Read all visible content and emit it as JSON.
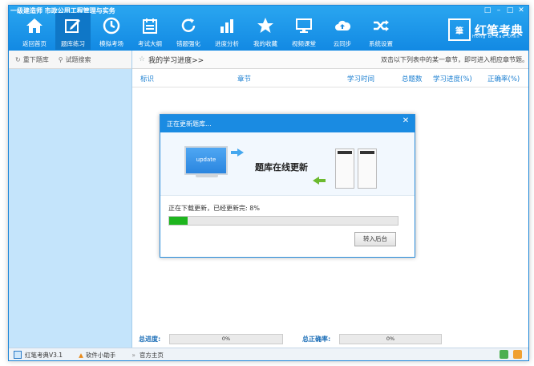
{
  "window": {
    "title": "一级建造师 市政公用工程管理与实务",
    "controls": [
      "□",
      "–",
      "□",
      "✕"
    ]
  },
  "toolbar": {
    "items": [
      {
        "label": "返回首页",
        "icon": "home-icon"
      },
      {
        "label": "题库练习",
        "icon": "edit-icon",
        "active": true
      },
      {
        "label": "模拟考场",
        "icon": "clock-icon"
      },
      {
        "label": "考试大纲",
        "icon": "calendar-icon"
      },
      {
        "label": "错题强化",
        "icon": "refresh-icon"
      },
      {
        "label": "进度分析",
        "icon": "bar-chart-icon"
      },
      {
        "label": "我的收藏",
        "icon": "star-icon"
      },
      {
        "label": "视频课堂",
        "icon": "monitor-icon"
      },
      {
        "label": "云同步",
        "icon": "cloud-icon"
      },
      {
        "label": "系统设置",
        "icon": "shuffle-icon"
      }
    ]
  },
  "brand": {
    "mark": "筆",
    "name": "红笔考典",
    "sub": "Hong Bi Kao Dian"
  },
  "sidebar": {
    "reload_label": "重下题库",
    "search_label": "试题搜索"
  },
  "content": {
    "breadcrumb": "我的学习进度>>",
    "hint": "双击以下列表中的某一章节，即可进入相应章节题。",
    "columns": [
      "标识",
      "章节",
      "学习时间",
      "总题数",
      "学习进度(%)",
      "正确率(%)"
    ]
  },
  "summary": {
    "total_progress_label": "总进度:",
    "total_progress_value": "0%",
    "total_accuracy_label": "总正确率:",
    "total_accuracy_value": "0%"
  },
  "statusbar": {
    "version": "红笔考典V3.1",
    "helper": "软件小助手",
    "homepage": "官方主页"
  },
  "dialog": {
    "title": "正在更新题库...",
    "close": "✕",
    "monitor_text": "update",
    "illus_title": "题库在线更新",
    "status_text": "正在下载更新，已经更新完: 8%",
    "progress": 0.08,
    "button_label": "转入后台"
  }
}
